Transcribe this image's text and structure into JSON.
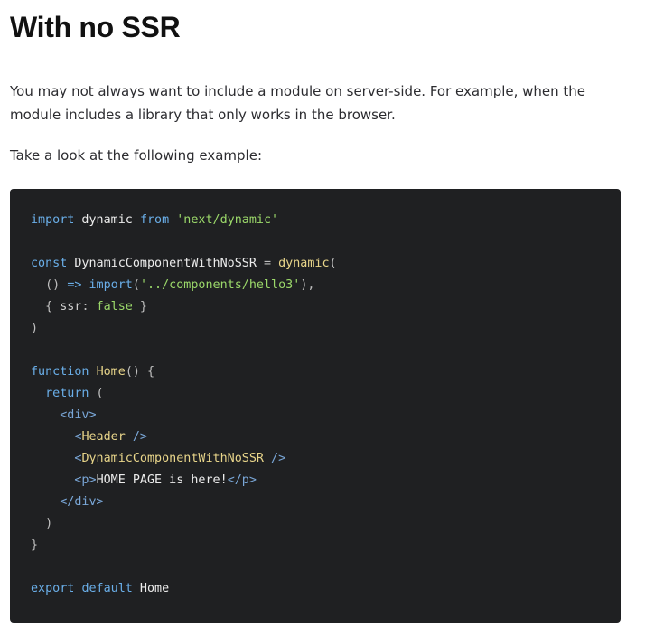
{
  "heading": "With no SSR",
  "paragraphs": {
    "intro": "You may not always want to include a module on server-side. For example, when the module includes a library that only works in the browser.",
    "lead": "Take a look at the following example:"
  },
  "code": {
    "language": "javascript",
    "lines": [
      [
        {
          "t": "keyword",
          "v": "import"
        },
        {
          "t": "ident",
          "v": " dynamic "
        },
        {
          "t": "keyword",
          "v": "from"
        },
        {
          "t": "ident",
          "v": " "
        },
        {
          "t": "string",
          "v": "'next/dynamic'"
        }
      ],
      [],
      [
        {
          "t": "keyword",
          "v": "const"
        },
        {
          "t": "ident",
          "v": " DynamicComponentWithNoSSR "
        },
        {
          "t": "punct",
          "v": "="
        },
        {
          "t": "ident",
          "v": " "
        },
        {
          "t": "fn",
          "v": "dynamic"
        },
        {
          "t": "punct",
          "v": "("
        }
      ],
      [
        {
          "t": "punct",
          "v": "  () "
        },
        {
          "t": "keyword",
          "v": "=>"
        },
        {
          "t": "ident",
          "v": " "
        },
        {
          "t": "keyword",
          "v": "import"
        },
        {
          "t": "punct",
          "v": "("
        },
        {
          "t": "string",
          "v": "'../components/hello3'"
        },
        {
          "t": "punct",
          "v": "),"
        }
      ],
      [
        {
          "t": "punct",
          "v": "  { "
        },
        {
          "t": "prop",
          "v": "ssr"
        },
        {
          "t": "punct",
          "v": ": "
        },
        {
          "t": "bool",
          "v": "false"
        },
        {
          "t": "punct",
          "v": " }"
        }
      ],
      [
        {
          "t": "punct",
          "v": ")"
        }
      ],
      [],
      [
        {
          "t": "keyword",
          "v": "function"
        },
        {
          "t": "ident",
          "v": " "
        },
        {
          "t": "fn",
          "v": "Home"
        },
        {
          "t": "punct",
          "v": "() {"
        }
      ],
      [
        {
          "t": "keyword",
          "v": "  return"
        },
        {
          "t": "punct",
          "v": " ("
        }
      ],
      [
        {
          "t": "tag",
          "v": "    <div>"
        }
      ],
      [
        {
          "t": "tag",
          "v": "      <"
        },
        {
          "t": "fn",
          "v": "Header"
        },
        {
          "t": "tag",
          "v": " />"
        }
      ],
      [
        {
          "t": "tag",
          "v": "      <"
        },
        {
          "t": "fn",
          "v": "DynamicComponentWithNoSSR"
        },
        {
          "t": "tag",
          "v": " />"
        }
      ],
      [
        {
          "t": "tag",
          "v": "      <p>"
        },
        {
          "t": "text",
          "v": "HOME PAGE is here!"
        },
        {
          "t": "tag",
          "v": "</p>"
        }
      ],
      [
        {
          "t": "tag",
          "v": "    </div>"
        }
      ],
      [
        {
          "t": "punct",
          "v": "  )"
        }
      ],
      [
        {
          "t": "punct",
          "v": "}"
        }
      ],
      [],
      [
        {
          "t": "keyword",
          "v": "export"
        },
        {
          "t": "ident",
          "v": " "
        },
        {
          "t": "keyword",
          "v": "default"
        },
        {
          "t": "ident",
          "v": " Home"
        }
      ]
    ]
  },
  "colors": {
    "code_background": "#1f2022",
    "keyword": "#6aaee8",
    "string": "#9bd86a",
    "function": "#e8d58a",
    "text": "#ececec"
  }
}
